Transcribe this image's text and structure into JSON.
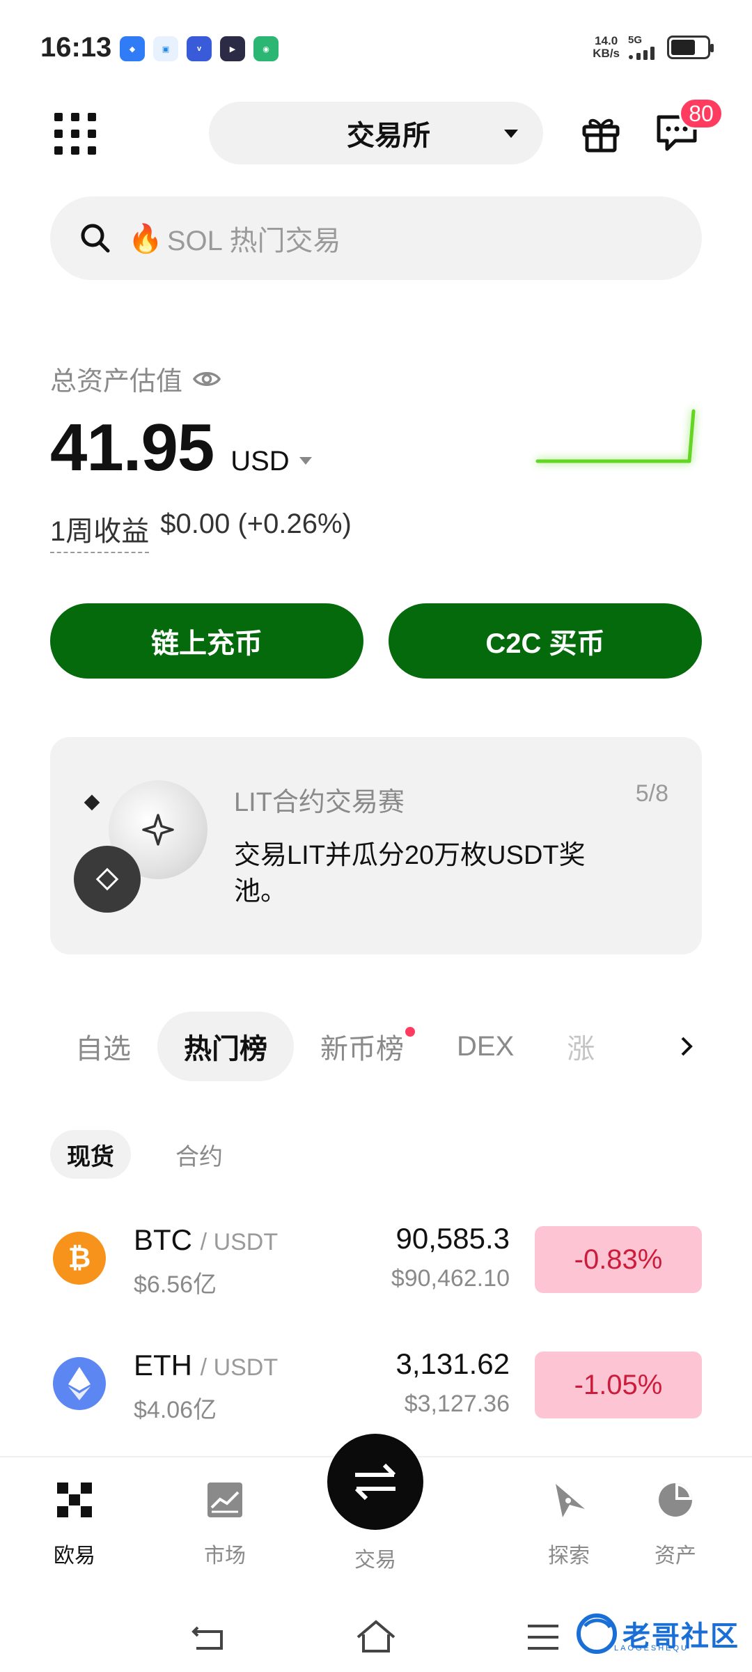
{
  "status_bar": {
    "time": "16:13",
    "net_speed_value": "14.0",
    "net_speed_unit": "KB/s",
    "network": "5G",
    "app_icons": [
      "blue-app-icon",
      "cloud-app-icon",
      "vivo-app-icon",
      "play-app-icon",
      "green-app-icon"
    ]
  },
  "header": {
    "exchange_label": "交易所",
    "notification_count": "80"
  },
  "search": {
    "placeholder": "SOL 热门交易"
  },
  "assets": {
    "label": "总资产估值",
    "value": "41.95",
    "currency": "USD",
    "week_pnl_label": "1周收益",
    "week_pnl_value": "$0.00 (+0.26%)"
  },
  "actions": {
    "deposit": "链上充币",
    "c2c": "C2C 买币"
  },
  "promo": {
    "title": "LIT合约交易赛",
    "counter": "5/8",
    "description": "交易LIT并瓜分20万枚USDT奖池。"
  },
  "tabs": [
    {
      "label": "自选"
    },
    {
      "label": "热门榜"
    },
    {
      "label": "新币榜"
    },
    {
      "label": "DEX"
    },
    {
      "label": "涨"
    }
  ],
  "subtabs": [
    {
      "label": "现货"
    },
    {
      "label": "合约"
    }
  ],
  "market": [
    {
      "symbol": "BTC",
      "quote": "/ USDT",
      "volume": "$6.56亿",
      "price": "90,585.3",
      "fiat": "$90,462.10",
      "change": "-0.83%",
      "color": "#f7931a"
    },
    {
      "symbol": "ETH",
      "quote": "/ USDT",
      "volume": "$4.06亿",
      "price": "3,131.62",
      "fiat": "$3,127.36",
      "change": "-1.05%",
      "color": "#5c87f2"
    }
  ],
  "bottom_nav": [
    {
      "label": "欧易"
    },
    {
      "label": "市场"
    },
    {
      "label": "交易"
    },
    {
      "label": "探索"
    },
    {
      "label": "资产"
    }
  ],
  "watermark": {
    "text": "老哥社区",
    "sub": "LAOGESHEQU"
  },
  "colors": {
    "primary_green": "#046a0c",
    "badge_red": "#ff3c5f",
    "down_red": "#cc1c3c",
    "down_bg": "#fdc5d3",
    "sparkline": "#62d620"
  }
}
